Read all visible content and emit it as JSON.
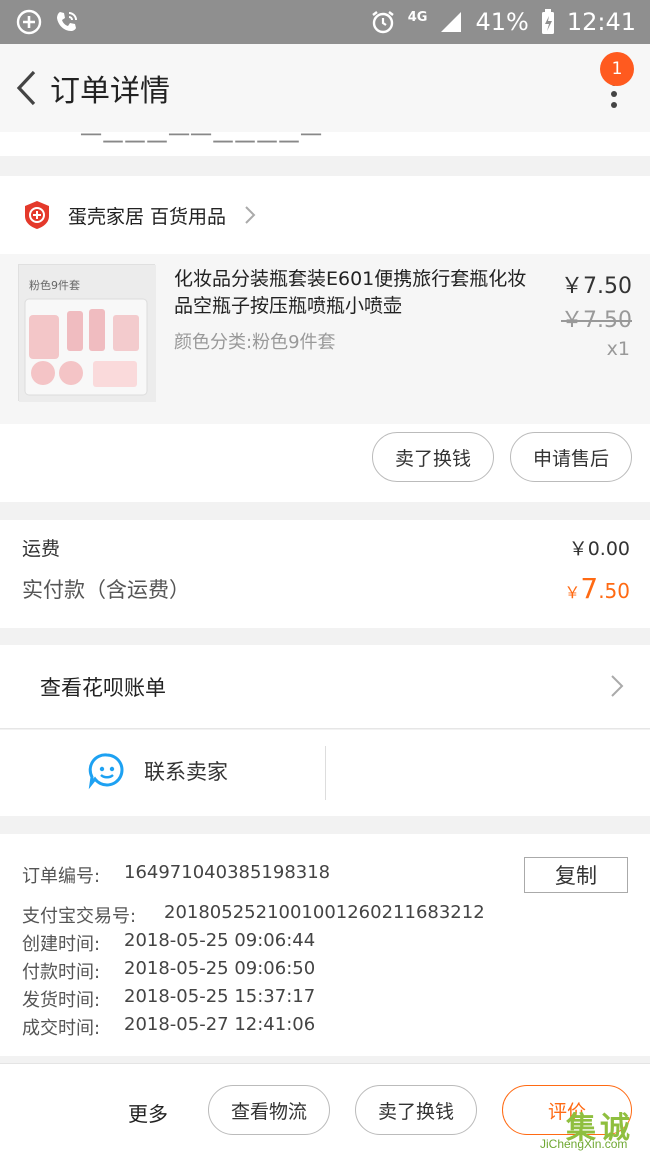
{
  "status_bar": {
    "network": "4G",
    "battery": "41%",
    "time": "12:41"
  },
  "nav": {
    "title": "订单详情",
    "badge_count": "1"
  },
  "cutoff_text": "一二二二一一二二二二一",
  "shop": {
    "name": "蛋壳家居 百货用品"
  },
  "product": {
    "thumb_text": "粉色9件套",
    "title": "化妆品分装瓶套装E601便携旅行套瓶化妆品空瓶子按压瓶喷瓶小喷壶",
    "variant": "颜色分类:粉色9件套",
    "price": "￥7.50",
    "original_price": "￥7.50",
    "quantity": "x1"
  },
  "product_actions": {
    "sell_label": "卖了换钱",
    "after_sale_label": "申请售后"
  },
  "fees": {
    "shipping_label": "运费",
    "shipping_value": "￥0.00",
    "paid_label": "实付款（含运费）",
    "paid_currency": "￥",
    "paid_int": "7",
    "paid_dec": ".50"
  },
  "huabei": {
    "label": "查看花呗账单"
  },
  "contact": {
    "label": "联系卖家"
  },
  "order_info": {
    "order_no_label": "订单编号:",
    "order_no": "164971040385198318",
    "copy_label": "复制",
    "alipay_label": "支付宝交易号:",
    "alipay_no": "2018052521001001260211683212",
    "created_label": "创建时间:",
    "created": "2018-05-25 09:06:44",
    "paid_label": "付款时间:",
    "paid": "2018-05-25 09:06:50",
    "shipped_label": "发货时间:",
    "shipped": "2018-05-25 15:37:17",
    "completed_label": "成交时间:",
    "completed": "2018-05-27 12:41:06"
  },
  "bottom_bar": {
    "more_label": "更多",
    "logistics_label": "查看物流",
    "sell_label": "卖了换钱",
    "review_label": "评价"
  },
  "watermark": {
    "chars": "集诚信",
    "url": "JiChengXin.com"
  },
  "colors": {
    "accent": "#ff6a13",
    "badge": "#ff5a1f",
    "status_bar": "#8f8f8f"
  }
}
